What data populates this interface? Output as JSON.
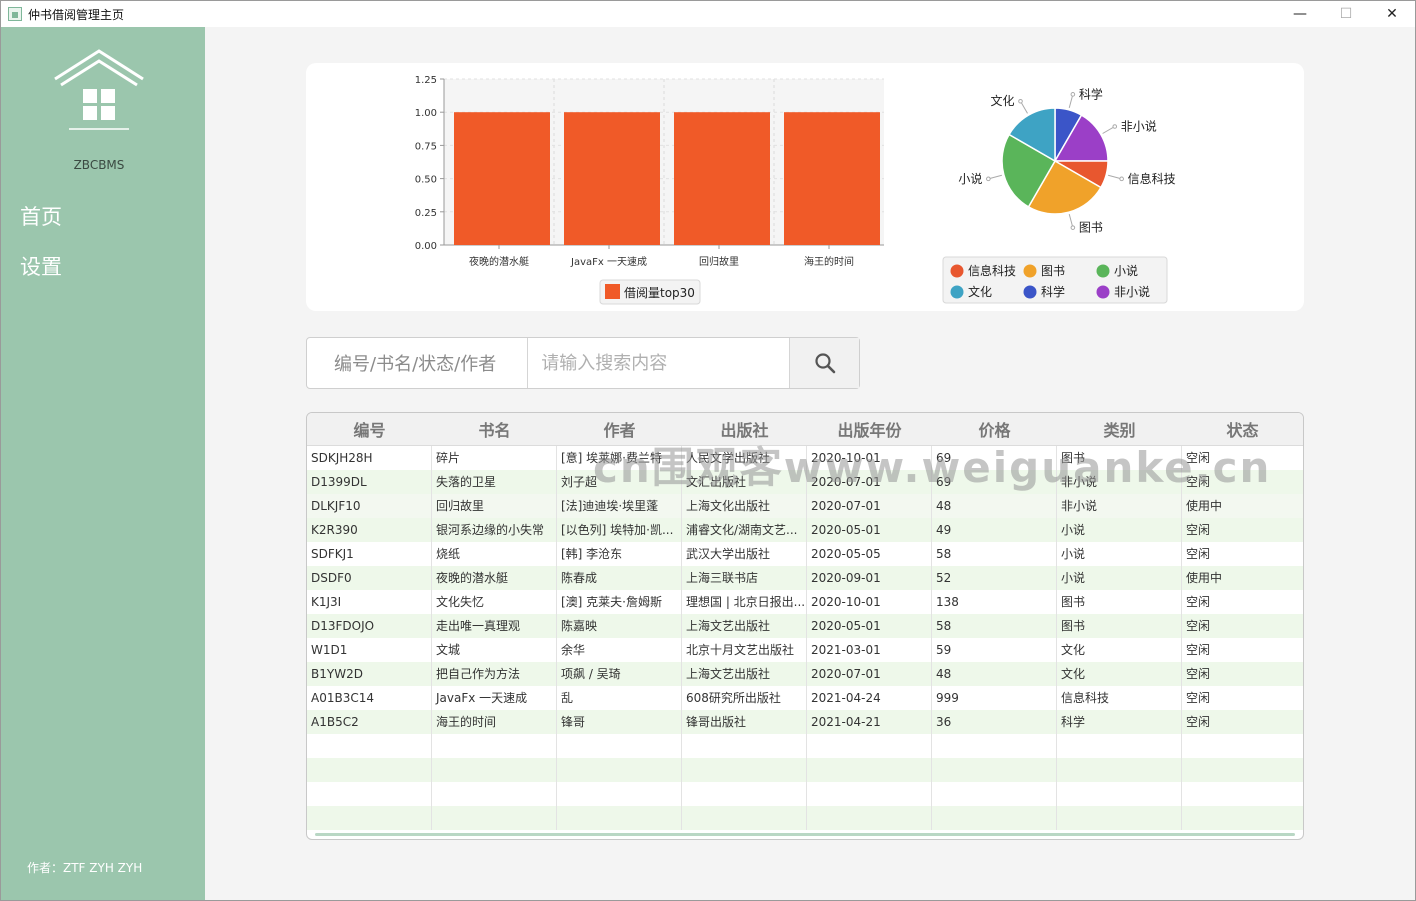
{
  "window": {
    "title": "仲书借阅管理主页",
    "min": "—",
    "max": "☐",
    "close": "✕"
  },
  "sidebar": {
    "brand": "ZBCBMS",
    "nav": [
      {
        "label": "首页"
      },
      {
        "label": "设置"
      }
    ],
    "author": "作者：ZTF ZYH ZYH",
    "color": "#9bc6ad"
  },
  "search": {
    "field_label": "编号/书名/状态/作者",
    "placeholder": "请输入搜索内容",
    "icon": "search-icon"
  },
  "watermark": "cn围观客www.weiguanke.cn",
  "chart_data": [
    {
      "type": "bar",
      "categories": [
        "夜晚的潜水艇",
        "JavaFx 一天速成",
        "回归故里",
        "海王的时间"
      ],
      "series": [
        {
          "name": "借阅量top30",
          "values": [
            1,
            1,
            1,
            1
          ],
          "color": "#f05a28"
        }
      ],
      "ylim": [
        0,
        1.25
      ],
      "yticks": [
        "0.00",
        "0.25",
        "0.50",
        "0.75",
        "1.00",
        "1.25"
      ],
      "grid": true,
      "legend": "bottom"
    },
    {
      "type": "pie",
      "slices": [
        {
          "name": "信息科技",
          "value": 1,
          "color": "#e8572f"
        },
        {
          "name": "图书",
          "value": 3,
          "color": "#f0a22a"
        },
        {
          "name": "小说",
          "value": 3,
          "color": "#5ab55a"
        },
        {
          "name": "文化",
          "value": 2,
          "color": "#3ea3c4"
        },
        {
          "name": "科学",
          "value": 1,
          "color": "#3b55c8"
        },
        {
          "name": "非小说",
          "value": 2,
          "color": "#9b3fc7"
        }
      ],
      "legend": "bottom"
    }
  ],
  "table": {
    "headers": [
      "编号",
      "书名",
      "作者",
      "出版社",
      "出版年份",
      "价格",
      "类别",
      "状态"
    ],
    "rows": [
      [
        "SDKJH28H",
        "碎片",
        "[意] 埃莱娜·费兰特",
        "人民文学出版社",
        "2020-10-01",
        "69",
        "图书",
        "空闲"
      ],
      [
        "D1399DL",
        "失落的卫星",
        "刘子超",
        "文汇出版社",
        "2020-07-01",
        "69",
        "非小说",
        "空闲"
      ],
      [
        "DLKJF10",
        "回归故里",
        "[法]迪迪埃·埃里蓬",
        "上海文化出版社",
        "2020-07-01",
        "48",
        "非小说",
        "使用中"
      ],
      [
        "K2R390",
        "银河系边缘的小失常",
        "[以色列] 埃特加·凯...",
        "浦睿文化/湖南文艺...",
        "2020-05-01",
        "49",
        "小说",
        "空闲"
      ],
      [
        "SDFKJ1",
        "烧纸",
        "[韩] 李沧东",
        "武汉大学出版社",
        "2020-05-05",
        "58",
        "小说",
        "空闲"
      ],
      [
        "DSDF0",
        "夜晚的潜水艇",
        "陈春成",
        "上海三联书店",
        "2020-09-01",
        "52",
        "小说",
        "使用中"
      ],
      [
        "K1J3I",
        "文化失忆",
        "[澳] 克莱夫·詹姆斯",
        "理想国 | 北京日报出...",
        "2020-10-01",
        "138",
        "图书",
        "空闲"
      ],
      [
        "D13FDOJO",
        "走出唯一真理观",
        "陈嘉映",
        "上海文艺出版社",
        "2020-05-01",
        "58",
        "图书",
        "空闲"
      ],
      [
        "W1D1",
        "文城",
        "余华",
        "北京十月文艺出版社",
        "2021-03-01",
        "59",
        "文化",
        "空闲"
      ],
      [
        "B1YW2D",
        "把自己作为方法",
        "项飙 / 吴琦",
        "上海文艺出版社",
        "2020-07-01",
        "48",
        "文化",
        "空闲"
      ],
      [
        "A01B3C14",
        "JavaFx 一天速成",
        "乱",
        "608研究所出版社",
        "2021-04-24",
        "999",
        "信息科技",
        "空闲"
      ],
      [
        "A1B5C2",
        "海王的时间",
        "锋哥",
        "锋哥出版社",
        "2021-04-21",
        "36",
        "科学",
        "空闲"
      ]
    ]
  }
}
